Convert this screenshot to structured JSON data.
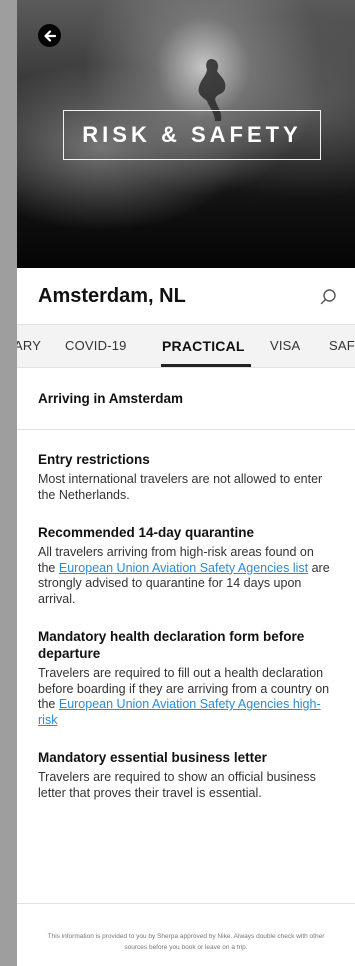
{
  "hero": {
    "title": "RISK & SAFETY"
  },
  "header": {
    "city": "Amsterdam, NL"
  },
  "tabs": [
    {
      "label": "ARY"
    },
    {
      "label": "COVID-19"
    },
    {
      "label": "PRACTICAL"
    },
    {
      "label": "VISA"
    },
    {
      "label": "SAF"
    }
  ],
  "active_tab": "PRACTICAL",
  "section": {
    "title": "Arriving in Amsterdam"
  },
  "items": [
    {
      "title": "Entry restrictions",
      "body_1": "Most international travelers are not allowed to enter the Netherlands."
    },
    {
      "title": "Recommended 14-day quarantine",
      "body_1": "All travelers arriving from high-risk areas found on the ",
      "link": "European Union Aviation Safety Agencies list",
      "body_2": " are strongly advised to quarantine for 14 days upon arrival."
    },
    {
      "title": "Mandatory health declaration form before departure",
      "body_1": "Travelers are required to fill out a health declaration before boarding if they are arriving from a country on the ",
      "link": "European Union Aviation Safety Agencies high-risk"
    },
    {
      "title": "Mandatory essential business letter",
      "body_1": "Travelers are required to show an official business letter that proves their travel is essential."
    }
  ],
  "footer": {
    "note": "This information is provided to you by Sherpa approved by Nike. Always double check with other sources before you book or leave on a trip."
  },
  "icons": {
    "back": "arrow-left-icon",
    "search": "search-icon"
  },
  "colors": {
    "link": "#2b8bd6",
    "active_tab_indicator": "#222222",
    "tab_bar_bg": "#f3f3f3"
  }
}
